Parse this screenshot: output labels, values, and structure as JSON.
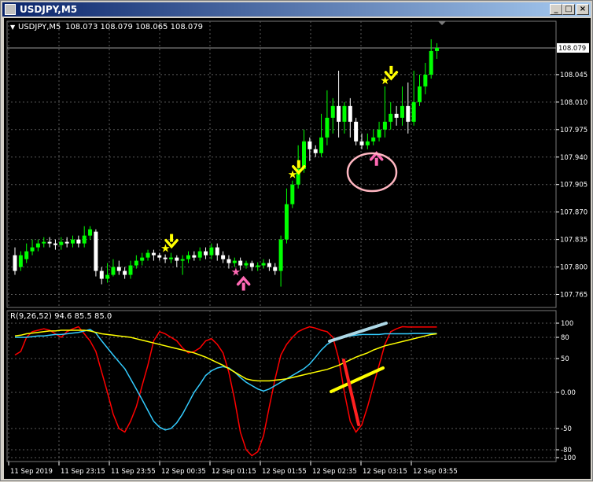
{
  "window": {
    "title": "USDJPY,M5",
    "buttons": {
      "minimize": "_",
      "restore": "□",
      "close": "×"
    }
  },
  "chart_header": {
    "symbol": "USDJPY,M5",
    "ohlc": "108.073 108.079 108.065 108.079"
  },
  "indicator_label": "R(9,26,52) 94.6 85.5 85.0",
  "colors": {
    "background": "#000000",
    "grid": "#5a5a5a",
    "bull_candle": "#00ff00",
    "bear_candle": "#ffffff",
    "signal_down_arrow": "#ffff00",
    "signal_up_arrow": "#ff69b4",
    "fast_line": "#ff0000",
    "mid_line": "#33ccff",
    "slow_line": "#ffff00",
    "annotation_circle": "#ffb6c1"
  },
  "price_axis": {
    "current": "108.079",
    "ticks": [
      "108.045",
      "108.010",
      "107.975",
      "107.940",
      "107.905",
      "107.870",
      "107.835",
      "107.800",
      "107.765"
    ]
  },
  "indicator_axis": {
    "ticks": [
      "100",
      "80",
      "50",
      "0.00",
      "-50",
      "-80",
      "-100"
    ]
  },
  "time_axis": {
    "ticks": [
      "11 Sep 2019",
      "11 Sep 23:15",
      "11 Sep 23:55",
      "12 Sep 00:35",
      "12 Sep 01:15",
      "12 Sep 01:55",
      "12 Sep 02:35",
      "12 Sep 03:15",
      "12 Sep 03:55"
    ]
  },
  "chart_data": [
    {
      "type": "candlestick",
      "title": "USDJPY,M5",
      "ylim": [
        107.765,
        108.1
      ],
      "candles": [
        [
          107.815,
          107.795,
          107.79,
          107.825
        ],
        [
          107.8,
          107.815,
          107.795,
          107.82
        ],
        [
          107.81,
          107.82,
          107.805,
          107.83
        ],
        [
          107.82,
          107.825,
          107.815,
          107.835
        ],
        [
          107.825,
          107.83,
          107.82,
          107.835
        ],
        [
          107.83,
          107.832,
          107.825,
          107.838
        ],
        [
          107.832,
          107.83,
          107.825,
          107.838
        ],
        [
          107.83,
          107.828,
          107.822,
          107.835
        ],
        [
          107.828,
          107.832,
          107.822,
          107.838
        ],
        [
          107.832,
          107.83,
          107.825,
          107.838
        ],
        [
          107.83,
          107.835,
          107.825,
          107.84
        ],
        [
          107.835,
          107.83,
          107.825,
          107.84
        ],
        [
          107.83,
          107.84,
          107.825,
          107.852
        ],
        [
          107.84,
          107.848,
          107.835,
          107.852
        ],
        [
          107.845,
          107.795,
          107.788,
          107.848
        ],
        [
          107.795,
          107.785,
          107.778,
          107.8
        ],
        [
          107.785,
          107.79,
          107.78,
          107.805
        ],
        [
          107.79,
          107.8,
          107.788,
          107.81
        ],
        [
          107.8,
          107.795,
          107.79,
          107.808
        ],
        [
          107.795,
          107.79,
          107.785,
          107.8
        ],
        [
          107.79,
          107.802,
          107.785,
          107.808
        ],
        [
          107.802,
          107.808,
          107.798,
          107.815
        ],
        [
          107.808,
          107.812,
          107.802,
          107.818
        ],
        [
          107.812,
          107.818,
          107.808,
          107.822
        ],
        [
          107.818,
          107.815,
          107.808,
          107.822
        ],
        [
          107.815,
          107.812,
          107.808,
          107.818
        ],
        [
          107.812,
          107.81,
          107.805,
          107.816
        ],
        [
          107.81,
          107.812,
          107.805,
          107.818
        ],
        [
          107.812,
          107.808,
          107.8,
          107.815
        ],
        [
          107.808,
          107.81,
          107.79,
          107.815
        ],
        [
          107.81,
          107.815,
          107.805,
          107.82
        ],
        [
          107.815,
          107.812,
          107.808,
          107.82
        ],
        [
          107.812,
          107.82,
          107.808,
          107.825
        ],
        [
          107.82,
          107.815,
          107.81,
          107.825
        ],
        [
          107.815,
          107.825,
          107.81,
          107.83
        ],
        [
          107.825,
          107.815,
          107.808,
          107.83
        ],
        [
          107.815,
          107.81,
          107.805,
          107.82
        ],
        [
          107.81,
          107.805,
          107.798,
          107.815
        ],
        [
          107.805,
          107.808,
          107.8,
          107.812
        ],
        [
          107.808,
          107.802,
          107.796,
          107.812
        ],
        [
          107.802,
          107.805,
          107.798,
          107.808
        ],
        [
          107.805,
          107.8,
          107.795,
          107.808
        ],
        [
          107.8,
          107.802,
          107.795,
          107.806
        ],
        [
          107.802,
          107.805,
          107.798,
          107.81
        ],
        [
          107.805,
          107.8,
          107.795,
          107.81
        ],
        [
          107.8,
          107.795,
          107.79,
          107.805
        ],
        [
          107.795,
          107.835,
          107.775,
          107.84
        ],
        [
          107.835,
          107.88,
          107.83,
          107.9
        ],
        [
          107.88,
          107.905,
          107.875,
          107.91
        ],
        [
          107.905,
          107.925,
          107.9,
          107.955
        ],
        [
          107.925,
          107.96,
          107.92,
          107.975
        ],
        [
          107.96,
          107.95,
          107.935,
          107.965
        ],
        [
          107.95,
          107.945,
          107.94,
          107.955
        ],
        [
          107.945,
          107.965,
          107.94,
          107.995
        ],
        [
          107.965,
          107.99,
          107.955,
          108.025
        ],
        [
          107.99,
          108.005,
          107.97,
          108.015
        ],
        [
          108.005,
          107.985,
          107.965,
          108.05
        ],
        [
          107.985,
          108.005,
          107.97,
          108.01
        ],
        [
          108.005,
          107.985,
          107.965,
          108.015
        ],
        [
          107.985,
          107.96,
          107.955,
          107.99
        ],
        [
          107.96,
          107.955,
          107.95,
          107.97
        ],
        [
          107.955,
          107.96,
          107.95,
          107.97
        ],
        [
          107.96,
          107.965,
          107.955,
          107.975
        ],
        [
          107.965,
          107.975,
          107.96,
          107.985
        ],
        [
          107.975,
          107.985,
          107.965,
          108.03
        ],
        [
          107.985,
          107.995,
          107.975,
          108.01
        ],
        [
          107.995,
          107.99,
          107.98,
          108.005
        ],
        [
          107.99,
          108.005,
          107.98,
          108.03
        ],
        [
          108.005,
          107.985,
          107.97,
          108.035
        ],
        [
          107.985,
          108.01,
          107.98,
          108.05
        ],
        [
          108.01,
          108.03,
          108.005,
          108.045
        ],
        [
          108.03,
          108.045,
          108.02,
          108.06
        ],
        [
          108.045,
          108.075,
          108.04,
          108.09
        ],
        [
          108.075,
          108.079,
          108.065,
          108.085
        ]
      ],
      "signals_sell": [
        26,
        48,
        64
      ],
      "signals_buy_idx": [
        39,
        62
      ],
      "signals_buy_labels": [
        "stars-and-arrow",
        "arrow"
      ]
    },
    {
      "type": "line",
      "title": "R(9,26,52) 94.6 85.5 85.0",
      "ylim": [
        -100,
        100
      ],
      "series": [
        {
          "name": "fast",
          "color": "#ff0000",
          "values": [
            55,
            60,
            80,
            88,
            90,
            92,
            90,
            85,
            80,
            88,
            92,
            95,
            85,
            75,
            60,
            30,
            0,
            -30,
            -50,
            -55,
            -40,
            -20,
            10,
            40,
            75,
            88,
            85,
            80,
            75,
            65,
            58,
            60,
            65,
            75,
            78,
            70,
            58,
            30,
            -10,
            -55,
            -80,
            -95,
            -85,
            -60,
            -20,
            20,
            55,
            70,
            80,
            88,
            92,
            95,
            93,
            90,
            88,
            80,
            50,
            0,
            -40,
            -55,
            -45,
            -20,
            10,
            40,
            70,
            88,
            92,
            95,
            94.6,
            94.6,
            94.6,
            94.6,
            94.6,
            94.6
          ]
        },
        {
          "name": "mid",
          "color": "#33ccff",
          "values": [
            80,
            80,
            80,
            81,
            82,
            82,
            83,
            84,
            84,
            85,
            86,
            87,
            89,
            91,
            86,
            75,
            65,
            55,
            45,
            35,
            20,
            5,
            -10,
            -25,
            -40,
            -48,
            -52,
            -50,
            -42,
            -30,
            -15,
            0,
            12,
            25,
            32,
            36,
            38,
            36,
            30,
            22,
            15,
            10,
            5,
            2,
            5,
            10,
            15,
            20,
            25,
            30,
            35,
            42,
            52,
            62,
            70,
            75,
            78,
            80,
            82,
            83,
            84,
            84,
            84,
            84,
            85,
            85,
            85,
            85,
            85,
            85.5,
            85.5,
            85.5,
            85.5,
            85.5
          ]
        },
        {
          "name": "slow",
          "color": "#ffff00",
          "values": [
            82,
            83,
            85,
            86,
            87,
            88,
            89,
            89,
            90,
            90,
            90,
            90,
            90,
            89,
            87,
            85,
            84,
            83,
            82,
            81,
            80,
            78,
            76,
            74,
            72,
            70,
            68,
            66,
            64,
            62,
            60,
            58,
            55,
            52,
            48,
            44,
            40,
            35,
            30,
            25,
            20,
            18,
            17,
            17,
            17,
            18,
            19,
            20,
            22,
            24,
            26,
            28,
            30,
            32,
            34,
            37,
            40,
            44,
            48,
            52,
            55,
            58,
            62,
            65,
            68,
            70,
            72,
            74,
            76,
            78,
            80,
            82,
            84,
            85
          ]
        }
      ]
    }
  ]
}
